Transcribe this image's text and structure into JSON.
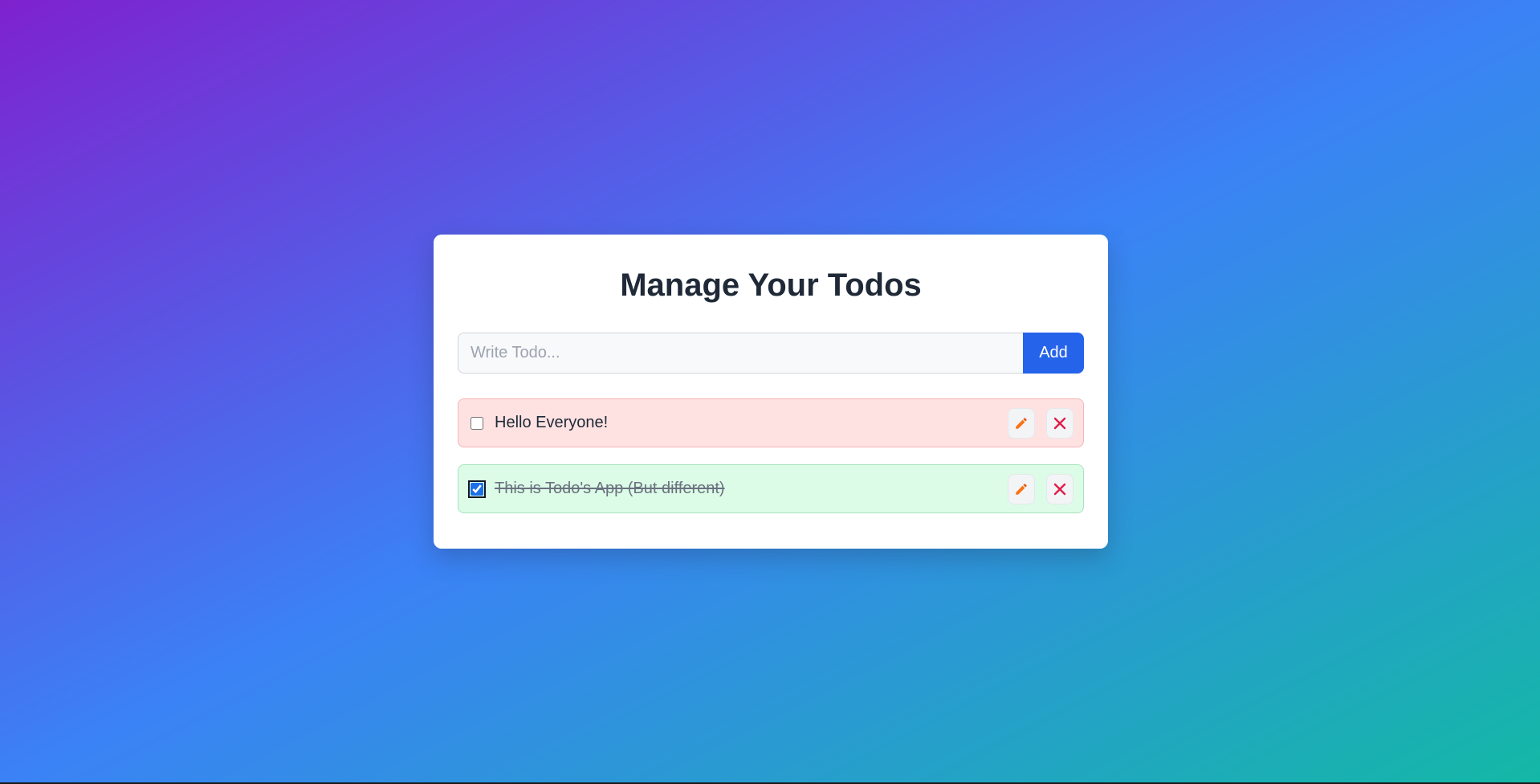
{
  "header": {
    "title": "Manage Your Todos"
  },
  "form": {
    "placeholder": "Write Todo...",
    "value": "",
    "add_label": "Add"
  },
  "todos": [
    {
      "text": "Hello Everyone!",
      "completed": false
    },
    {
      "text": "This is Todo's App (But different)",
      "completed": true
    }
  ],
  "icons": {
    "edit": "pencil-icon",
    "delete": "close-icon"
  },
  "colors": {
    "accent": "#2563eb",
    "pending_bg": "#fee2e2",
    "done_bg": "#dcfce7",
    "edit_icon": "#f97316",
    "delete_icon": "#e11d48",
    "gradient_start": "#7e22ce",
    "gradient_mid": "#3b82f6",
    "gradient_end": "#14b8a6"
  }
}
